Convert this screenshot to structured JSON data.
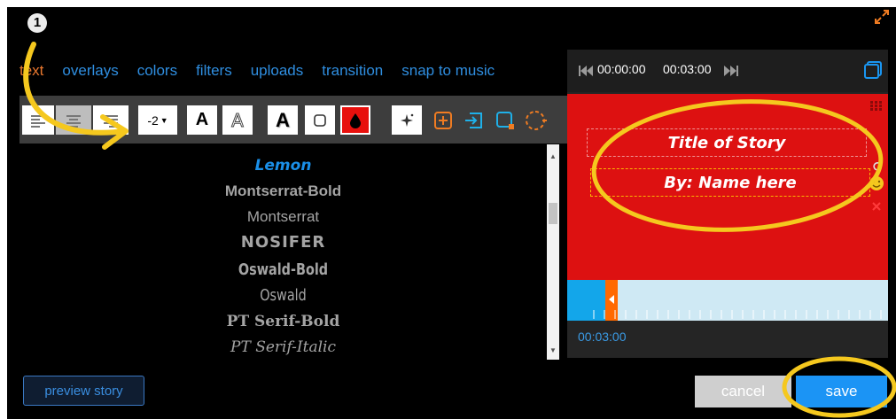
{
  "step_number": "1",
  "tabs": [
    {
      "label": "text",
      "active": true
    },
    {
      "label": "overlays"
    },
    {
      "label": "colors"
    },
    {
      "label": "filters"
    },
    {
      "label": "uploads"
    },
    {
      "label": "transition"
    },
    {
      "label": "snap to music"
    }
  ],
  "toolbar": {
    "line_spacing_value": "-2",
    "text_style_glyph": "A",
    "outline_style_glyph": "A",
    "shadow_style_glyph": "A"
  },
  "fonts": [
    {
      "name": "Lemon",
      "selected": true
    },
    {
      "name": "Montserrat-Bold"
    },
    {
      "name": "Montserrat"
    },
    {
      "name": "NOSIFER"
    },
    {
      "name": "Oswald-Bold"
    },
    {
      "name": "Oswald"
    },
    {
      "name": "PT Serif-Bold"
    },
    {
      "name": "PT Serif-Italic"
    }
  ],
  "preview_button_label": "preview story",
  "player": {
    "current_time": "00:00:00",
    "total_time": "00:03:00",
    "title_text": "Title of Story",
    "byline_text": "By: Name here",
    "timeline_readout": "00:03:00",
    "timeline_progress": 0.12
  },
  "cancel_label": "cancel",
  "save_label": "save",
  "colors": {
    "accent_blue": "#2f8ee0",
    "active_tab": "#e8772e",
    "stage_red": "#dd1111",
    "save_blue": "#1b94f5",
    "annotation_yellow": "#f5c81e"
  }
}
